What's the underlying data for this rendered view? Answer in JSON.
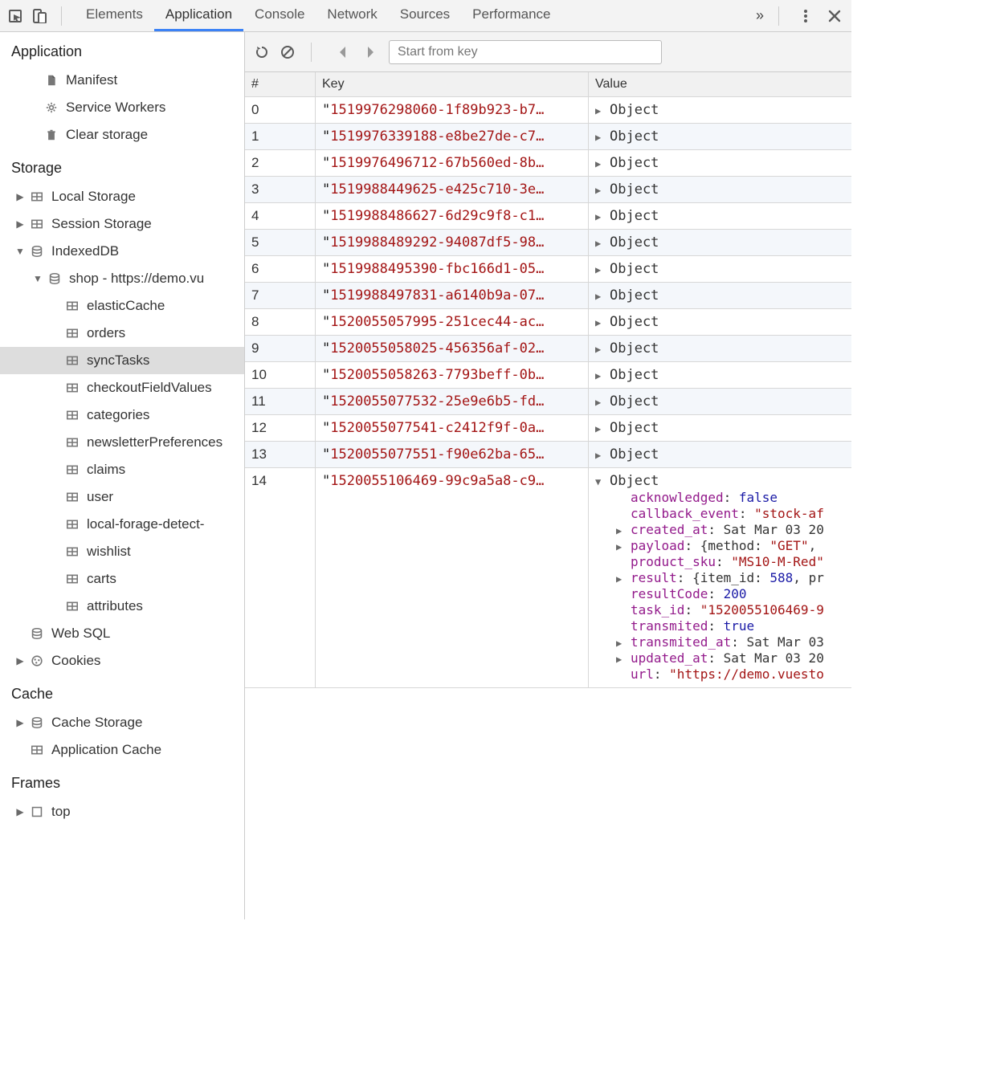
{
  "tabs": {
    "items": [
      "Elements",
      "Application",
      "Console",
      "Network",
      "Sources",
      "Performance"
    ],
    "activeIndex": 1,
    "overflow_glyph": "»"
  },
  "toolbar": {
    "search_placeholder": "Start from key"
  },
  "sidebar": {
    "section_application": {
      "title": "Application",
      "items": [
        {
          "label": "Manifest",
          "icon": "file"
        },
        {
          "label": "Service Workers",
          "icon": "gear"
        },
        {
          "label": "Clear storage",
          "icon": "trash"
        }
      ]
    },
    "section_storage": {
      "title": "Storage",
      "items": [
        {
          "label": "Local Storage",
          "icon": "table",
          "expandable": true,
          "expanded": false,
          "indent": 1
        },
        {
          "label": "Session Storage",
          "icon": "table",
          "expandable": true,
          "expanded": false,
          "indent": 1
        },
        {
          "label": "IndexedDB",
          "icon": "db",
          "expandable": true,
          "expanded": true,
          "indent": 1
        },
        {
          "label": "shop - https://demo.vu",
          "icon": "db",
          "expandable": true,
          "expanded": true,
          "indent": 2
        },
        {
          "label": "elasticCache",
          "icon": "table",
          "indent": 3
        },
        {
          "label": "orders",
          "icon": "table",
          "indent": 3
        },
        {
          "label": "syncTasks",
          "icon": "table",
          "indent": 3,
          "selected": true
        },
        {
          "label": "checkoutFieldValues",
          "icon": "table",
          "indent": 3
        },
        {
          "label": "categories",
          "icon": "table",
          "indent": 3
        },
        {
          "label": "newsletterPreferences",
          "icon": "table",
          "indent": 3
        },
        {
          "label": "claims",
          "icon": "table",
          "indent": 3
        },
        {
          "label": "user",
          "icon": "table",
          "indent": 3
        },
        {
          "label": "local-forage-detect-",
          "icon": "table",
          "indent": 3
        },
        {
          "label": "wishlist",
          "icon": "table",
          "indent": 3
        },
        {
          "label": "carts",
          "icon": "table",
          "indent": 3
        },
        {
          "label": "attributes",
          "icon": "table",
          "indent": 3
        },
        {
          "label": "Web SQL",
          "icon": "db",
          "indent": 1
        },
        {
          "label": "Cookies",
          "icon": "cookie",
          "expandable": true,
          "expanded": false,
          "indent": 1
        }
      ]
    },
    "section_cache": {
      "title": "Cache",
      "items": [
        {
          "label": "Cache Storage",
          "icon": "db",
          "expandable": true,
          "expanded": false,
          "indent": 1
        },
        {
          "label": "Application Cache",
          "icon": "table",
          "indent": 1
        }
      ]
    },
    "section_frames": {
      "title": "Frames",
      "items": [
        {
          "label": "top",
          "icon": "frame",
          "expandable": true,
          "expanded": false,
          "indent": 1
        }
      ]
    }
  },
  "table": {
    "headers": {
      "idx": "#",
      "key": "Key",
      "value": "Value"
    },
    "value_label": "Object",
    "rows": [
      {
        "idx": "0",
        "key": "1519976298060-1f89b923-b7…"
      },
      {
        "idx": "1",
        "key": "1519976339188-e8be27de-c7…"
      },
      {
        "idx": "2",
        "key": "1519976496712-67b560ed-8b…"
      },
      {
        "idx": "3",
        "key": "1519988449625-e425c710-3e…"
      },
      {
        "idx": "4",
        "key": "1519988486627-6d29c9f8-c1…"
      },
      {
        "idx": "5",
        "key": "1519988489292-94087df5-98…"
      },
      {
        "idx": "6",
        "key": "1519988495390-fbc166d1-05…"
      },
      {
        "idx": "7",
        "key": "1519988497831-a6140b9a-07…"
      },
      {
        "idx": "8",
        "key": "1520055057995-251cec44-ac…"
      },
      {
        "idx": "9",
        "key": "1520055058025-456356af-02…"
      },
      {
        "idx": "10",
        "key": "1520055058263-7793beff-0b…"
      },
      {
        "idx": "11",
        "key": "1520055077532-25e9e6b5-fd…"
      },
      {
        "idx": "12",
        "key": "1520055077541-c2412f9f-0a…"
      },
      {
        "idx": "13",
        "key": "1520055077551-f90e62ba-65…"
      },
      {
        "idx": "14",
        "key": "1520055106469-99c9a5a8-c9…",
        "expanded": true
      }
    ],
    "expandedObject": {
      "lines": [
        {
          "toggle": "",
          "prop": "acknowledged",
          "sep": ": ",
          "val": "false",
          "cls": "vbool"
        },
        {
          "toggle": "",
          "prop": "callback_event",
          "sep": ": ",
          "val": "\"stock-af",
          "cls": "vstr"
        },
        {
          "toggle": "▶",
          "prop": "created_at",
          "sep": ": ",
          "val": "Sat Mar 03 20",
          "cls": "vplain"
        },
        {
          "toggle": "▶",
          "prop": "payload",
          "sep": ": ",
          "val": "{method: \"GET\",",
          "cls": "vplain",
          "method_str": "GET"
        },
        {
          "toggle": "",
          "prop": "product_sku",
          "sep": ": ",
          "val": "\"MS10-M-Red\"",
          "cls": "vstr"
        },
        {
          "toggle": "▶",
          "prop": "result",
          "sep": ": ",
          "val": "{item_id: 588, pr",
          "cls": "vplain",
          "item_id": "588"
        },
        {
          "toggle": "",
          "prop": "resultCode",
          "sep": ": ",
          "val": "200",
          "cls": "vnum"
        },
        {
          "toggle": "",
          "prop": "task_id",
          "sep": ": ",
          "val": "\"1520055106469-9",
          "cls": "vstr"
        },
        {
          "toggle": "",
          "prop": "transmited",
          "sep": ": ",
          "val": "true",
          "cls": "vbool"
        },
        {
          "toggle": "▶",
          "prop": "transmited_at",
          "sep": ": ",
          "val": "Sat Mar 03",
          "cls": "vplain"
        },
        {
          "toggle": "▶",
          "prop": "updated_at",
          "sep": ": ",
          "val": "Sat Mar 03 20",
          "cls": "vplain"
        },
        {
          "toggle": "",
          "prop": "url",
          "sep": ": ",
          "val": "\"https://demo.vuesto",
          "cls": "vstr"
        }
      ]
    }
  }
}
